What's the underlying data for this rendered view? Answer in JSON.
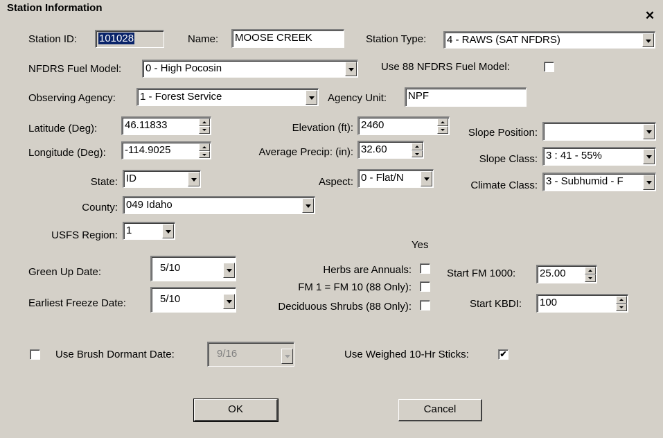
{
  "window": {
    "title": "Station Information",
    "close_glyph": "✕"
  },
  "station": {
    "id_label": "Station ID:",
    "id_value": "101028",
    "name_label": "Name:",
    "name_value": "MOOSE CREEK",
    "type_label": "Station Type:",
    "type_value": "4 - RAWS (SAT NFDRS)"
  },
  "fuel": {
    "model_label": "NFDRS Fuel Model:",
    "model_value": "0 - High Pocosin",
    "use88_label": "Use 88 NFDRS Fuel Model:",
    "use88_checked": false
  },
  "agency": {
    "label": "Observing Agency:",
    "value": "1 - Forest Service",
    "unit_label": "Agency Unit:",
    "unit_value": "NPF"
  },
  "location": {
    "lat_label": "Latitude (Deg):",
    "lat_value": "46.11833",
    "lon_label": "Longitude (Deg):",
    "lon_value": "-114.9025",
    "state_label": "State:",
    "state_value": "ID",
    "county_label": "County:",
    "county_value": "049 Idaho",
    "region_label": "USFS Region:",
    "region_value": "1",
    "elev_label": "Elevation (ft):",
    "elev_value": "2460",
    "precip_label": "Average Precip: (in):",
    "precip_value": "32.60",
    "aspect_label": "Aspect:",
    "aspect_value": "0 - Flat/N",
    "slopepos_label": "Slope Position:",
    "slopepos_value": "",
    "slopeclass_label": "Slope Class:",
    "slopeclass_value": "3 : 41 - 55%",
    "climate_label": "Climate Class:",
    "climate_value": "3 - Subhumid - F"
  },
  "seasonal": {
    "yes_header": "Yes",
    "greenup_label": "Green Up Date:",
    "greenup_value": "5/10",
    "freeze_label": "Earliest Freeze Date:",
    "freeze_value": "5/10",
    "herbs_label": "Herbs are Annuals:",
    "herbs_checked": false,
    "fm1_label": "FM 1 = FM 10 (88 Only):",
    "fm1_checked": false,
    "decid_label": "Deciduous Shrubs (88 Only):",
    "decid_checked": false,
    "fm1000_label": "Start FM 1000:",
    "fm1000_value": "25.00",
    "kbdi_label": "Start KBDI:",
    "kbdi_value": "100",
    "brush_label": "Use Brush Dormant Date:",
    "brush_checked": false,
    "brush_value": "9/16",
    "weighed_label": "Use Weighed 10-Hr Sticks:",
    "weighed_checked": true
  },
  "buttons": {
    "ok": "OK",
    "cancel": "Cancel"
  }
}
